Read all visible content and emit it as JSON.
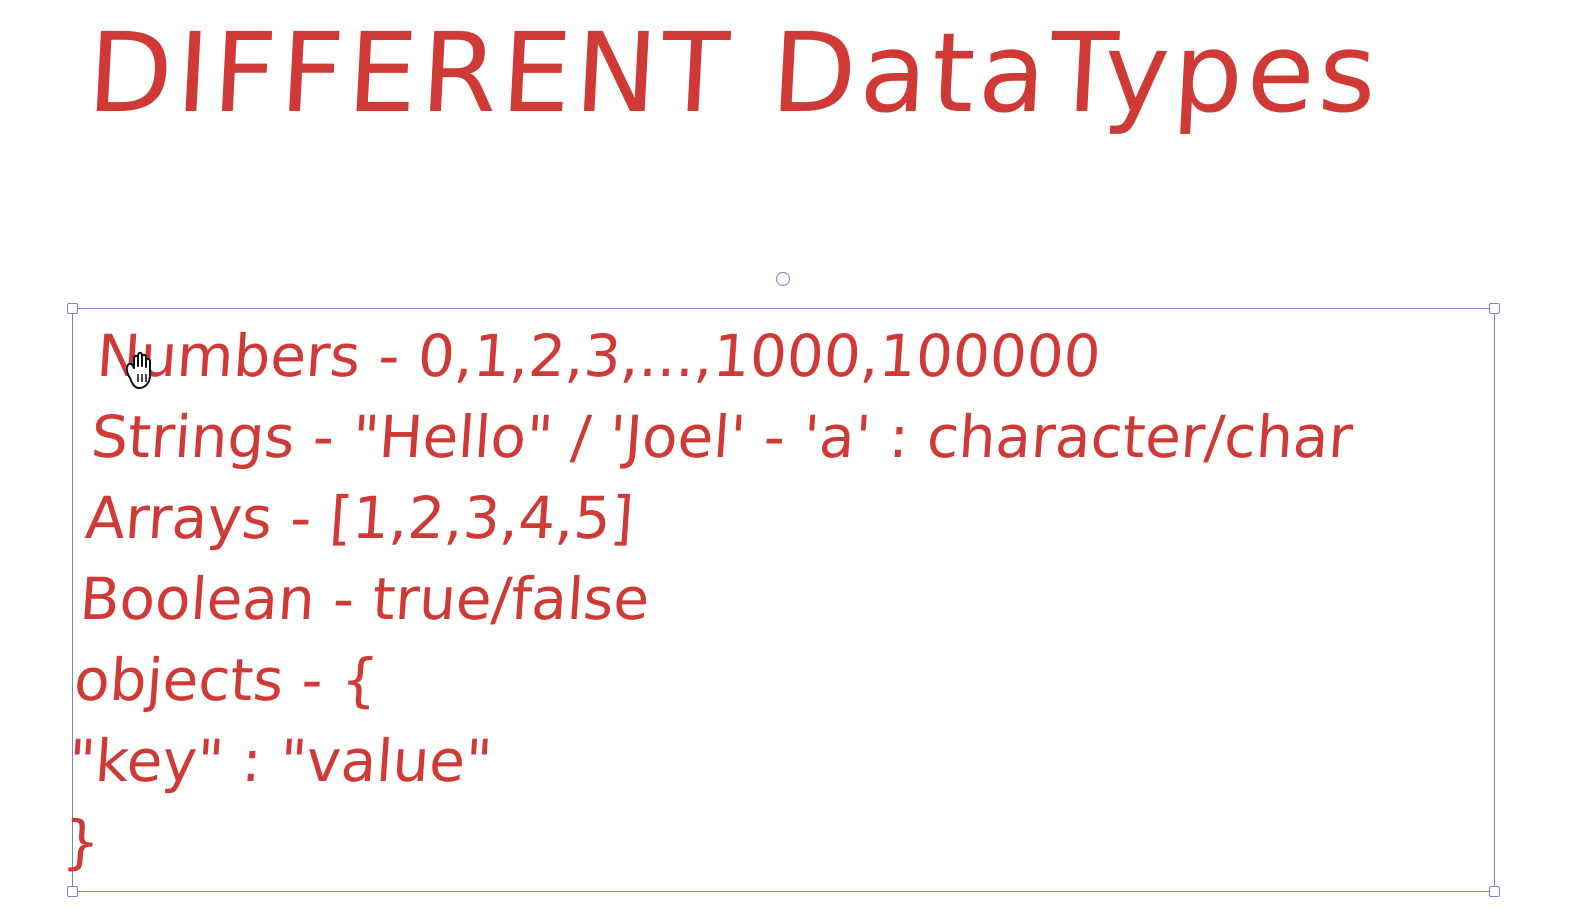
{
  "title": "DIFFERENT DataTypes",
  "lines": [
    "Numbers - 0,1,2,3,...,1000,100000",
    "Strings - \"Hello\" / 'Joel' - 'a' : character/char",
    "Arrays - [1,2,3,4,5]",
    "Boolean - true/false",
    "objects - {",
    "\"key\" : \"value\"",
    "}"
  ],
  "colors": {
    "ink": "#d03a36",
    "selection": "#7b7fd6",
    "background": "#ffffff"
  },
  "icons": {
    "cursor": "hand-grab-icon",
    "rotate": "rotate-handle-icon"
  }
}
